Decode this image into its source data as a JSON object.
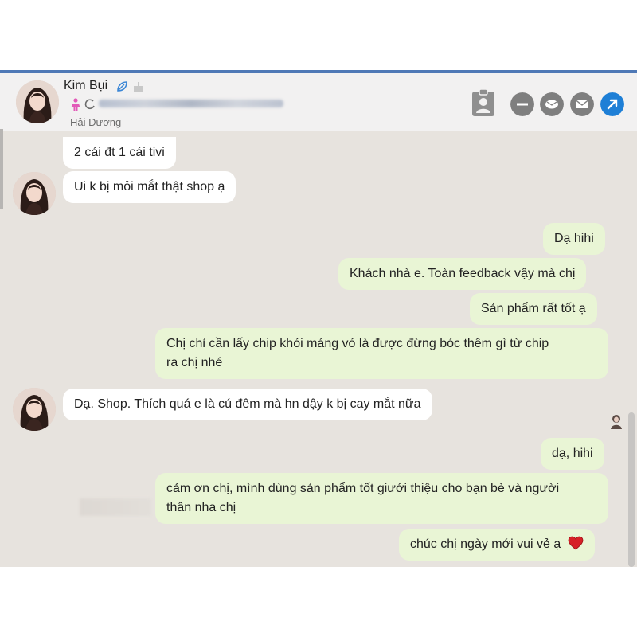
{
  "contact": {
    "name": "Kim Bụi",
    "location": "Hải Dương"
  },
  "messages": [
    {
      "from": "customer",
      "text": "2 cái đt 1 cái tivi"
    },
    {
      "from": "customer",
      "text": "Ui k bị mỏi mắt thật shop ạ"
    },
    {
      "from": "shop",
      "text": "Dạ hihi"
    },
    {
      "from": "shop",
      "text": "Khách nhà e. Toàn feedback vậy mà chị"
    },
    {
      "from": "shop",
      "text": "Sản phẩm rất tốt ạ"
    },
    {
      "from": "shop",
      "text": "Chị chỉ cần lấy chip khỏi máng vỏ là được đừng bóc thêm gì từ chip",
      "text2": "ra chị nhé"
    },
    {
      "from": "customer",
      "text": "Dạ. Shop. Thích quá e là cú đêm mà hn dậy k bị cay mắt nữa"
    },
    {
      "from": "shop",
      "text": "dạ, hihi"
    },
    {
      "from": "shop",
      "text": "cảm ơn chị, mình dùng sản phẩm tốt giưới thiệu cho bạn bè và người",
      "text2": "thân nha chị"
    },
    {
      "from": "shop",
      "text": "chúc chị ngày mới vui vẻ ạ"
    }
  ],
  "icons": {
    "verified": "leaf-icon",
    "birthday": "cake-icon",
    "gender": "female-icon",
    "loading": "spinner-icon",
    "contact": "contact-card-icon",
    "minus": "minus-icon",
    "message": "message-icon",
    "email": "email-icon",
    "external": "external-link-icon",
    "heart": "heart-icon",
    "seen": "seen-avatar-icon"
  },
  "colors": {
    "incoming_bubble": "#ffffff",
    "outgoing_bubble": "#e9f5d5",
    "chat_background": "#e7e3de",
    "header_background": "#f2f1f1",
    "accent_blue": "#1e7fd6",
    "grey_button": "#7f7f7f",
    "heart": "#d62027"
  }
}
